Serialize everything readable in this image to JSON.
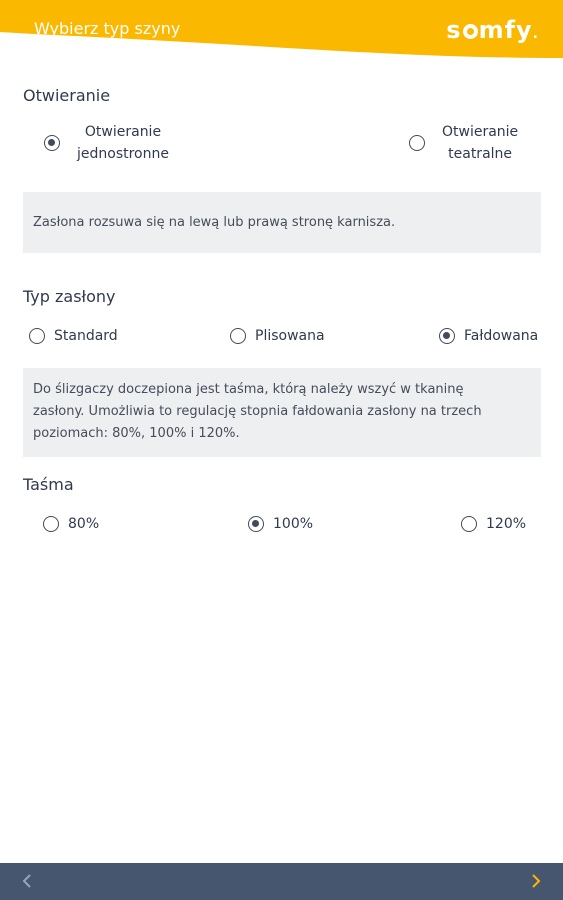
{
  "header": {
    "title": "Wybierz typ szyny",
    "logo_text_left": "s",
    "logo_text_right": "mfy",
    "logo_mark": ".",
    "accent_color": "#fbb800"
  },
  "opening": {
    "title": "Otwieranie",
    "options": [
      {
        "line1": "Otwieranie",
        "line2": "jednostronne",
        "selected": true
      },
      {
        "line1": "Otwieranie",
        "line2": "teatralne",
        "selected": false
      }
    ],
    "description": "Zasłona rozsuwa się na lewą lub prawą stronę karnisza."
  },
  "curtain_type": {
    "title": "Typ zasłony",
    "options": [
      {
        "label": "Standard",
        "selected": false
      },
      {
        "label": "Plisowana",
        "selected": false
      },
      {
        "label": "Fałdowana",
        "selected": true
      }
    ],
    "description_line1": "Do ślizgaczy doczepiona jest taśma, którą należy wszyć w tkaninę",
    "description_line2": "zasłony. Umożliwia to regulację stopnia fałdowania zasłony na trzech",
    "description_line3": "poziomach: 80%, 100% i 120%."
  },
  "tape": {
    "title": "Taśma",
    "options": [
      {
        "label": "80%",
        "selected": false
      },
      {
        "label": "100%",
        "selected": true
      },
      {
        "label": "120%",
        "selected": false
      }
    ]
  },
  "footer": {
    "prev_icon": "chevron-left-icon",
    "next_icon": "chevron-right-icon",
    "prev_color": "#9aa3b3",
    "next_color": "#fbb800"
  }
}
